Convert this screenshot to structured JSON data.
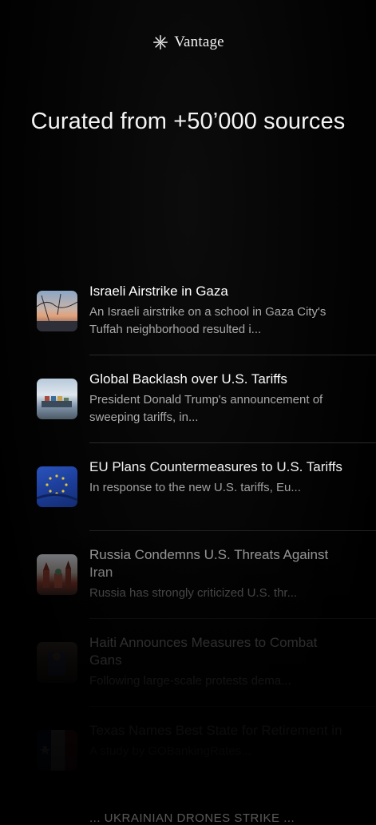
{
  "brand": {
    "name": "Vantage",
    "icon": "sparkle-icon"
  },
  "hero": {
    "title": "Curated from +50’000 sources"
  },
  "feed": {
    "items": [
      {
        "title": "Israeli Airstrike in Gaza",
        "summary": "An Israeli airstrike on a school in Gaza City's Tuffah neighborhood resulted i..."
      },
      {
        "title": "Global Backlash over U.S. Tariffs",
        "summary": "President Donald Trump's announcement of sweeping tariffs, in..."
      },
      {
        "title": "EU Plans Countermeasures to U.S. Tariffs",
        "summary": "In response to the new U.S. tariffs, Eu..."
      },
      {
        "title": "Russia Condemns U.S. Threats Against Iran",
        "summary": "Russia has strongly criticized U.S. thr..."
      },
      {
        "title": "Haiti Announces Measures to Combat Gans",
        "summary": "Following large-scale protests dema..."
      },
      {
        "title": "Texas Names Best State for Retirement in",
        "summary": "A study by GOBankingRates..."
      }
    ],
    "cut_off_text": "... UKRAINIAN DRONES STRIKE ..."
  }
}
